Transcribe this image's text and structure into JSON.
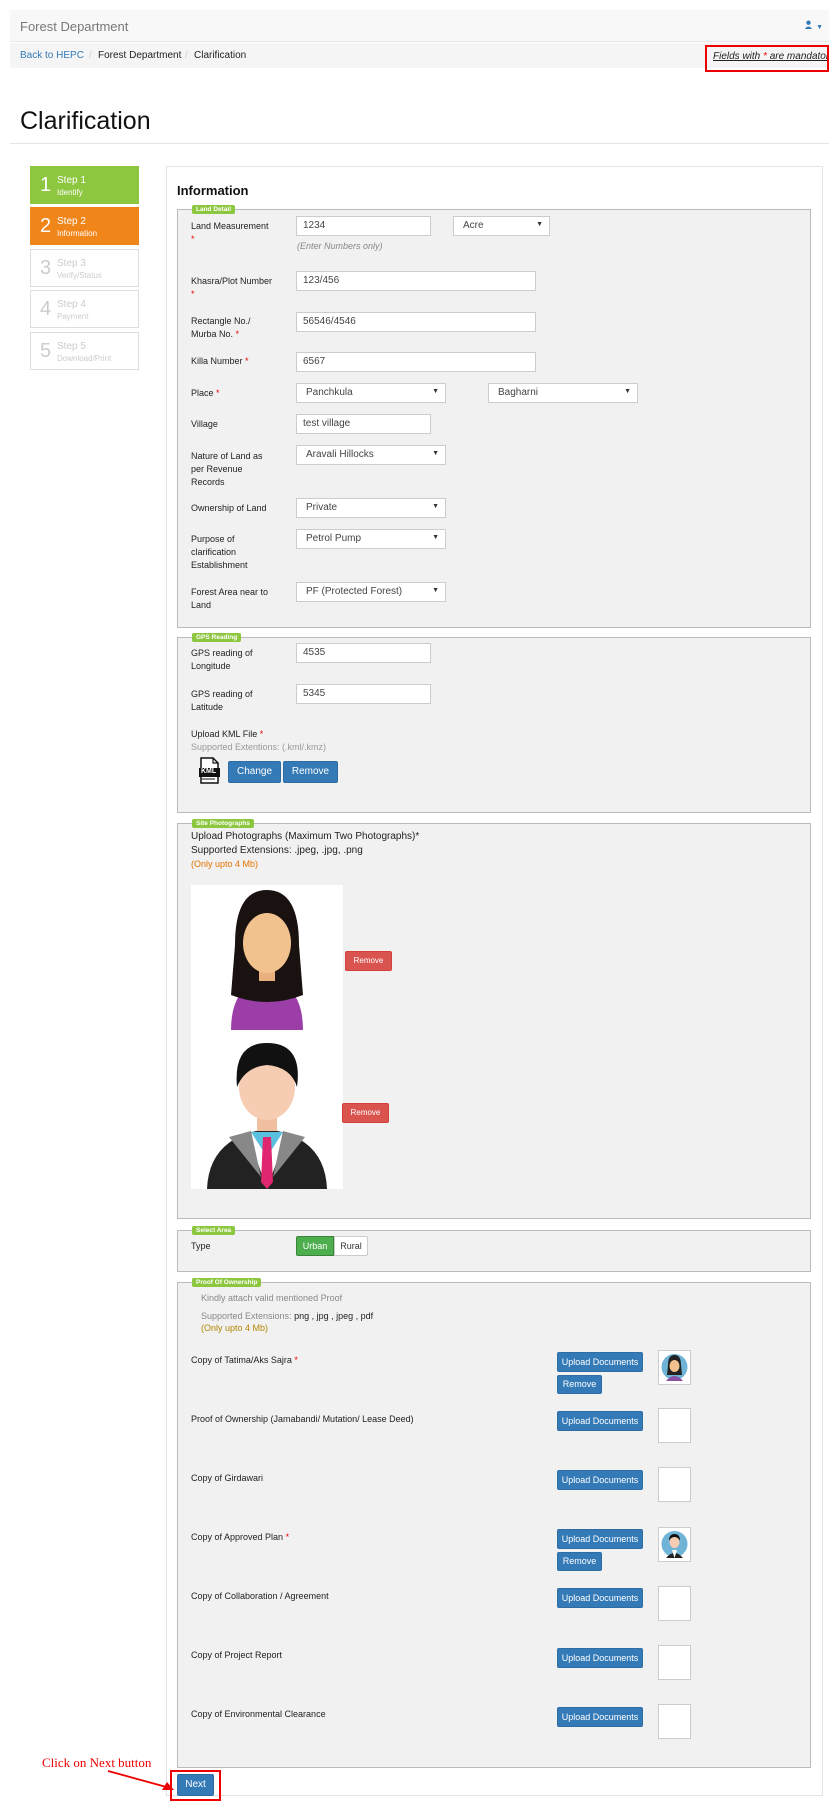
{
  "navbar": {
    "brand": "Forest Department",
    "user_icon": "user-icon"
  },
  "breadcrumb": {
    "items": [
      "Back to HEPC",
      "Forest Department",
      "Clarification"
    ],
    "separator": "/"
  },
  "mandatory_note": {
    "prefix": "Fields with ",
    "star": "*",
    "suffix": " are mandatory"
  },
  "page_title": "Clarification",
  "steps": [
    {
      "num": "1",
      "title": "Step 1",
      "sub": "Identify",
      "state": "done"
    },
    {
      "num": "2",
      "title": "Step 2",
      "sub": "Information",
      "state": "current"
    },
    {
      "num": "3",
      "title": "Step 3",
      "sub": "Verify/Status",
      "state": "todo"
    },
    {
      "num": "4",
      "title": "Step 4",
      "sub": "Payment",
      "state": "todo"
    },
    {
      "num": "5",
      "title": "Step 5",
      "sub": "Download/Print",
      "state": "todo"
    }
  ],
  "section_title": "Information",
  "land": {
    "legend": "Land Detail",
    "measurement_label": "Land Measurement",
    "measurement_value": "1234",
    "measurement_unit": "Acre",
    "measurement_hint": "(Enter Numbers only)",
    "khasra_label": "Khasra/Plot Number",
    "khasra_value": "123/456",
    "rect_label1": "Rectangle No./",
    "rect_label2": "Murba No.",
    "rect_value": "56546/4546",
    "killa_label": "Killa Number",
    "killa_value": "6567",
    "place_label": "Place",
    "place_value": "Panchkula",
    "place_value2": "Bagharni",
    "village_label": "Village",
    "village_value": "test village",
    "nature_label1": "Nature of Land as",
    "nature_label2": "per Revenue",
    "nature_label3": "Records",
    "nature_value": "Aravali Hillocks",
    "ownership_label": "Ownership of Land",
    "ownership_value": "Private",
    "purpose_label1": "Purpose of",
    "purpose_label2": "clarification",
    "purpose_label3": "Establishment",
    "purpose_value": "Petrol Pump",
    "forest_label1": "Forest Area near to",
    "forest_label2": "Land",
    "forest_value": "PF (Protected Forest)"
  },
  "gps": {
    "legend": "GPS Reading",
    "long_label1": "GPS reading of",
    "long_label2": "Longitude",
    "long_value": "4535",
    "lat_label1": "GPS reading of",
    "lat_label2": "Latitude",
    "lat_value": "5345",
    "kml_label": "Upload KML File",
    "kml_hint": "Supported Extentions: (.kml/.kmz)",
    "kml_icon_text": "KML",
    "change_btn": "Change",
    "remove_btn": "Remove"
  },
  "photos": {
    "legend": "Site Photographs",
    "line1": "Upload Photographs (Maximum Two Photographs)*",
    "line2": "Supported Extensions: .jpeg, .jpg, .png",
    "line3": "(Only upto 4 Mb)",
    "remove1": "Remove",
    "remove2": "Remove"
  },
  "area": {
    "legend": "Select Area",
    "type_label": "Type",
    "urban": "Urban",
    "rural": "Rural"
  },
  "proof": {
    "legend": "Proof Of Ownership",
    "note": "Kindly attach valid mentioned Proof",
    "ext_prefix": "Supported Extensions: ",
    "ext_value": "png , jpg , jpeg , pdf",
    "size_note": "(Only upto 4 Mb)",
    "upload_label": "Upload Documents",
    "remove_label": "Remove",
    "docs": [
      {
        "label": "Copy of Tatima/Aks Sajra",
        "required": true
      },
      {
        "label": "Proof of Ownership (Jamabandi/ Mutation/ Lease Deed)",
        "required": false
      },
      {
        "label": "Copy of Girdawari",
        "required": false
      },
      {
        "label": "Copy of Approved Plan",
        "required": true
      },
      {
        "label": "Copy of Collaboration / Agreement",
        "required": false
      },
      {
        "label": "Copy of Project Report",
        "required": false
      },
      {
        "label": "Copy of Environmental Clearance",
        "required": false
      }
    ]
  },
  "annotation": "Click on Next button",
  "next_btn": "Next",
  "colors": {
    "green": "#8dc63f",
    "orange": "#f0851a",
    "blue": "#337ab7",
    "red": "#d9534f",
    "annotation": "#e00000"
  }
}
